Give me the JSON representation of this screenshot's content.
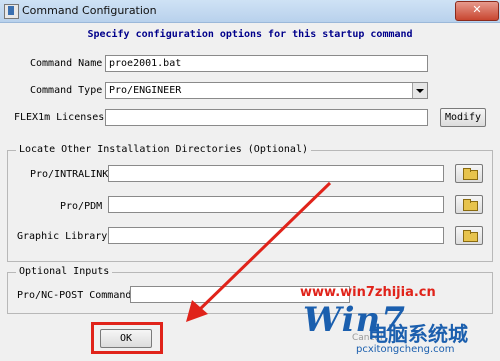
{
  "window": {
    "title": "Command Configuration",
    "close_label": "✕"
  },
  "header": "Specify configuration options for this startup command",
  "form": {
    "command_name": {
      "label": "Command Name",
      "value": "proe2001.bat"
    },
    "command_type": {
      "label": "Command Type",
      "value": "Pro/ENGINEER"
    },
    "flexlm": {
      "label": "FLEX1m Licenses",
      "value": "",
      "button": "Modify"
    }
  },
  "dirs": {
    "legend": "Locate Other Installation Directories (Optional)",
    "rows": [
      {
        "label": "Pro/INTRALINK",
        "value": ""
      },
      {
        "label": "Pro/PDM",
        "value": ""
      },
      {
        "label": "Graphic Library",
        "value": ""
      }
    ]
  },
  "inputs": {
    "legend": "Optional Inputs",
    "nc_post": {
      "label": "Pro/NC-POST Command",
      "value": ""
    }
  },
  "buttons": {
    "ok": "OK",
    "cancel": "Cancel"
  },
  "watermark": {
    "url": "www.win7zhijia.cn",
    "logo": "Win7",
    "cn": "电脑系统城",
    "sub": "pcxitongcheng.com"
  },
  "colors": {
    "annotation": "#e0231a",
    "header_text": "#00008b",
    "watermark": "#1b5fae"
  }
}
